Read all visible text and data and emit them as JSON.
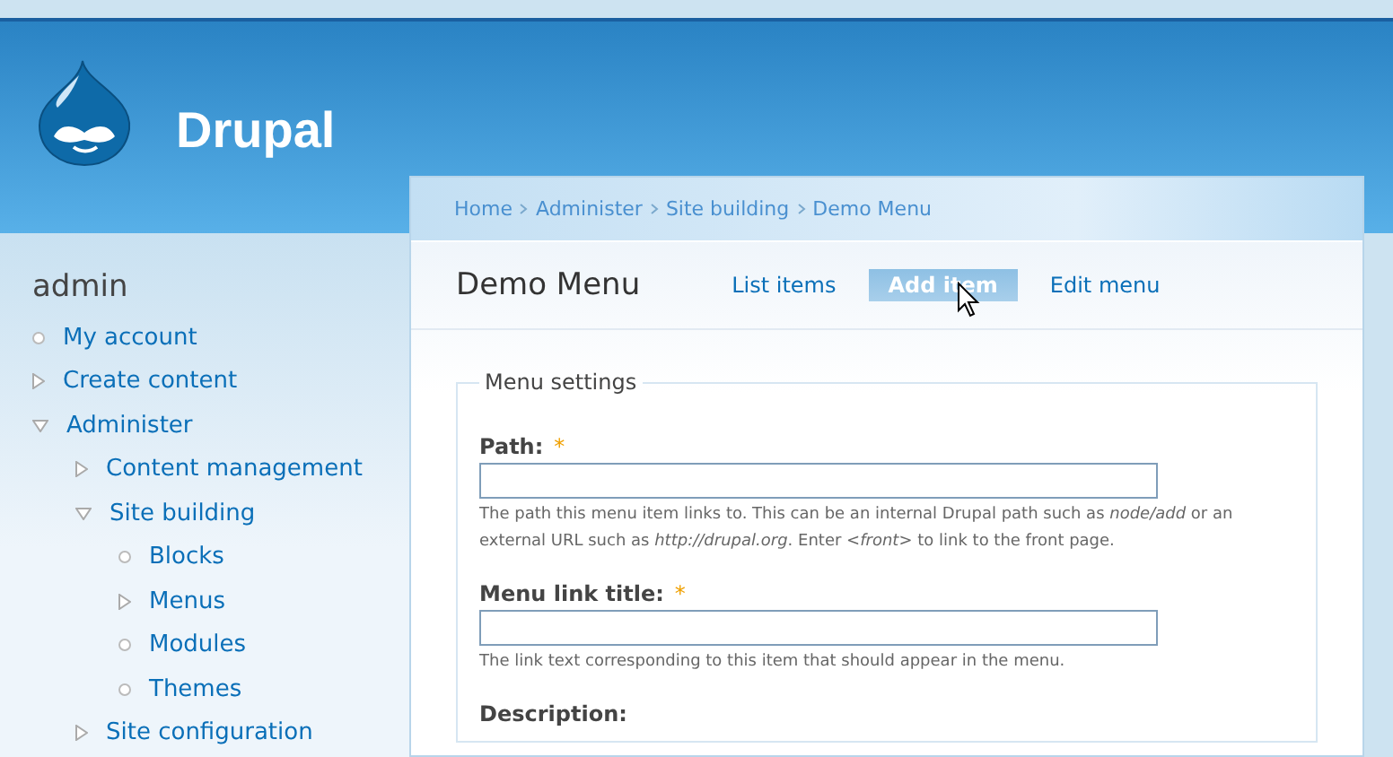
{
  "site": {
    "name": "Drupal"
  },
  "sidebar": {
    "title": "admin",
    "items": [
      {
        "label": "My account",
        "kind": "leaf"
      },
      {
        "label": "Create content",
        "kind": "branch",
        "expanded": false
      },
      {
        "label": "Administer",
        "kind": "branch",
        "expanded": true,
        "children": [
          {
            "label": "Content management",
            "kind": "branch",
            "expanded": false
          },
          {
            "label": "Site building",
            "kind": "branch",
            "expanded": true,
            "children": [
              {
                "label": "Blocks",
                "kind": "leaf"
              },
              {
                "label": "Menus",
                "kind": "branch",
                "expanded": false
              },
              {
                "label": "Modules",
                "kind": "leaf"
              },
              {
                "label": "Themes",
                "kind": "leaf"
              }
            ]
          },
          {
            "label": "Site configuration",
            "kind": "branch",
            "expanded": false
          }
        ]
      }
    ]
  },
  "breadcrumb": [
    "Home",
    "Administer",
    "Site building",
    "Demo Menu"
  ],
  "page_title": "Demo Menu",
  "tabs": [
    {
      "label": "List items",
      "selected": false
    },
    {
      "label": "Add item",
      "selected": true
    },
    {
      "label": "Edit menu",
      "selected": false
    }
  ],
  "fieldset": {
    "legend": "Menu settings",
    "fields": [
      {
        "label": "Path:",
        "required_mark": "*",
        "help": "The path this menu item links to. This can be an internal Drupal path such as *node/add* or an external URL such as *http://drupal.org*. Enter *<front>* to link to the front page."
      },
      {
        "label": "Menu link title:",
        "required_mark": "*",
        "help": "The link text corresponding to this item that should appear in the menu."
      },
      {
        "label": "Description:"
      }
    ]
  }
}
